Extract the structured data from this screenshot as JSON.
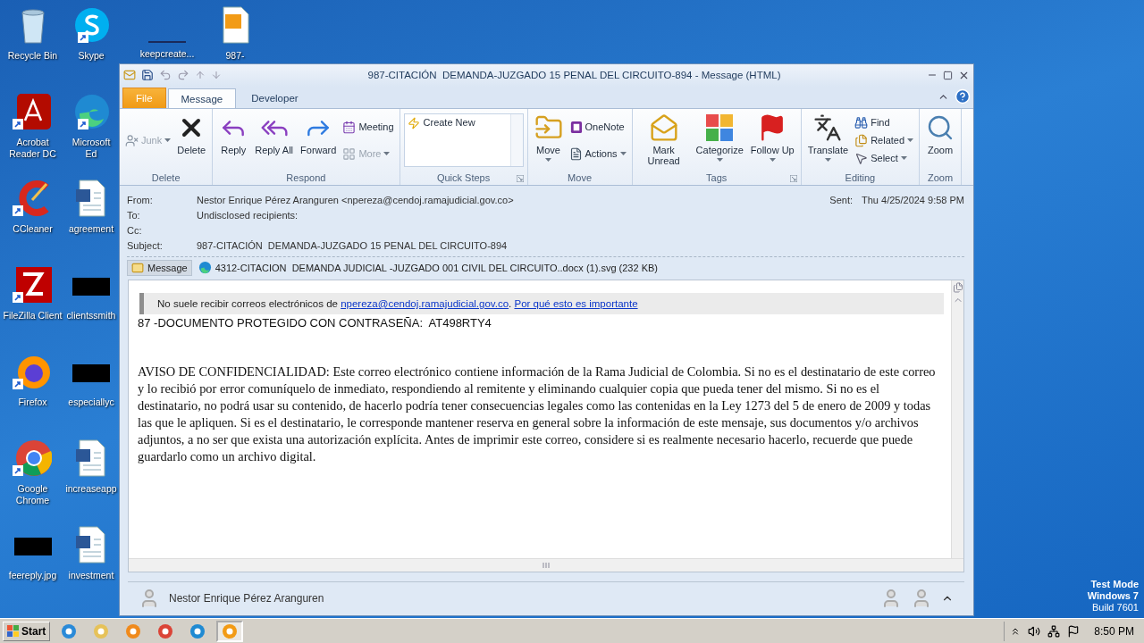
{
  "desktop": {
    "columns": [
      [
        {
          "label": "Recycle Bin",
          "kind": "recycle",
          "shortcut": false
        },
        {
          "label": "Acrobat Reader DC",
          "kind": "acrobat",
          "shortcut": true
        },
        {
          "label": "CCleaner",
          "kind": "ccleaner",
          "shortcut": true
        },
        {
          "label": "FileZilla Client",
          "kind": "filezilla",
          "shortcut": true
        },
        {
          "label": "Firefox",
          "kind": "firefox",
          "shortcut": true
        },
        {
          "label": "Google Chrome",
          "kind": "chrome",
          "shortcut": true
        },
        {
          "label": "feereply.jpg",
          "kind": "redacted",
          "shortcut": false
        }
      ],
      [
        {
          "label": "Skype",
          "kind": "skype",
          "shortcut": true
        },
        {
          "label": "Microsoft Ed",
          "kind": "edge",
          "shortcut": true
        },
        {
          "label": "agreement",
          "kind": "word",
          "shortcut": false
        },
        {
          "label": "clientssmith",
          "kind": "redacted",
          "shortcut": false
        },
        {
          "label": "especiallyc",
          "kind": "redacted",
          "shortcut": false
        },
        {
          "label": "increaseapp",
          "kind": "word",
          "shortcut": false
        },
        {
          "label": "investment",
          "kind": "word",
          "shortcut": false
        }
      ],
      [
        {
          "label": "keepcreate...",
          "kind": "blank",
          "shortcut": false
        }
      ],
      [
        {
          "label": "987-",
          "kind": "outlook-doc",
          "shortcut": false
        }
      ]
    ],
    "watermark_lines": [
      "Test Mode",
      "Windows 7",
      "Build 7601"
    ]
  },
  "window": {
    "title": "987-CITACIÓN  DEMANDA-JUZGADO 15 PENAL DEL CIRCUITO-894 - Message (HTML)",
    "tabs": [
      {
        "label": "File",
        "kind": "file",
        "selected": false
      },
      {
        "label": "Message",
        "kind": "tab",
        "selected": true
      },
      {
        "label": "Developer",
        "kind": "tab",
        "selected": false
      }
    ],
    "ribbon": [
      {
        "label": "Delete",
        "items": [
          {
            "label": "Junk",
            "kind": "junk",
            "disabled": true,
            "dropdown": true
          },
          {
            "label": "Delete",
            "kind": "delete",
            "disabled": false,
            "dropdown": false
          }
        ]
      },
      {
        "label": "Respond",
        "items": [
          {
            "label": "Reply",
            "kind": "reply",
            "disabled": false,
            "dropdown": false
          },
          {
            "label": "Reply All",
            "kind": "reply-all",
            "disabled": false,
            "dropdown": false
          },
          {
            "label": "Forward",
            "kind": "forward",
            "disabled": false,
            "dropdown": false
          },
          {
            "label": "Meeting",
            "kind": "meeting",
            "disabled": false,
            "dropdown": false
          },
          {
            "label": "More",
            "kind": "more",
            "disabled": true,
            "dropdown": true
          }
        ]
      },
      {
        "label": "Quick Steps",
        "launcher": true,
        "items": [
          {
            "label": "Create New",
            "kind": "quick-step"
          }
        ]
      },
      {
        "label": "Move",
        "items": [
          {
            "label": "Move",
            "kind": "move",
            "disabled": false,
            "dropdown": true
          },
          {
            "label": "OneNote",
            "kind": "onenote",
            "disabled": false,
            "dropdown": false
          },
          {
            "label": "Actions",
            "kind": "actions",
            "disabled": false,
            "dropdown": true
          }
        ]
      },
      {
        "label": "Tags",
        "launcher": true,
        "items": [
          {
            "label": "Mark Unread",
            "kind": "mark-unread",
            "disabled": false,
            "dropdown": false
          },
          {
            "label": "Categorize",
            "kind": "categorize",
            "disabled": false,
            "dropdown": true
          },
          {
            "label": "Follow Up",
            "kind": "follow-up",
            "disabled": false,
            "dropdown": true
          }
        ]
      },
      {
        "label": "Editing",
        "items": [
          {
            "label": "Translate",
            "kind": "translate",
            "disabled": false,
            "dropdown": true
          },
          {
            "label": "Find",
            "kind": "find",
            "disabled": false,
            "dropdown": false
          },
          {
            "label": "Related",
            "kind": "related",
            "disabled": false,
            "dropdown": true
          },
          {
            "label": "Select",
            "kind": "select",
            "disabled": false,
            "dropdown": true
          }
        ]
      },
      {
        "label": "Zoom",
        "items": [
          {
            "label": "Zoom",
            "kind": "zoom",
            "disabled": false,
            "dropdown": false
          }
        ]
      }
    ],
    "header": {
      "fields": [
        {
          "label": "From:",
          "value": "Nestor Enrique Pérez Aranguren <npereza@cendoj.ramajudicial.gov.co>"
        },
        {
          "label": "To:",
          "value": "Undisclosed recipients:"
        },
        {
          "label": "Cc:"
        },
        {
          "label": "Subject:",
          "value": "987-CITACIÓN  DEMANDA-JUZGADO 15 PENAL DEL CIRCUITO-894"
        }
      ],
      "sent": {
        "label": "Sent:",
        "value": "Thu 4/25/2024 9:58 PM"
      }
    },
    "attachments": [
      {
        "label": "Message",
        "kind": "message",
        "selected": true
      },
      {
        "label": "4312-CITACION  DEMANDA JUDICIAL -JUZGADO 001 CIVIL DEL CIRCUITO..docx (1).svg (232 KB)",
        "kind": "file",
        "selected": false
      }
    ],
    "body": {
      "notice": [
        {
          "kind": "text",
          "text": "No suele recibir correos electrónicos de "
        },
        {
          "kind": "link",
          "text": "npereza@cendoj.ramajudicial.gov.co"
        },
        {
          "kind": "text",
          "text": ". "
        },
        {
          "kind": "link",
          "text": "Por qué esto es importante"
        }
      ],
      "password_line": "87 -DOCUMENTO PROTEGIDO CON CONTRASEÑA:  AT498RTY4",
      "paragraph": "AVISO DE CONFIDENCIALIDAD: Este correo electrónico contiene información de la Rama Judicial de Colombia. Si no es el destinatario de este correo y lo recibió por error comuníquelo de inmediato, respondiendo al remitente y eliminando cualquier copia que pueda tener del mismo. Si no es el destinatario, no podrá usar su contenido, de hacerlo podría tener consecuencias legales como las contenidas en la Ley 1273 del 5 de enero de 2009 y todas las que le apliquen. Si es el destinatario, le corresponde mantener reserva en general sobre la información de este mensaje, sus documentos y/o archivos adjuntos, a no ser que exista una autorización explícita. Antes de imprimir este correo, considere si es realmente necesario hacerlo, recuerde que puede guardarlo como un archivo digital."
    },
    "people_pane": {
      "name": "Nestor Enrique Pérez Aranguren"
    }
  },
  "taskbar": {
    "start": "Start",
    "apps": [
      {
        "kind": "ie",
        "selected": false
      },
      {
        "kind": "explorer",
        "selected": false
      },
      {
        "kind": "media",
        "selected": false
      },
      {
        "kind": "chrome",
        "selected": false
      },
      {
        "kind": "edge",
        "selected": false
      },
      {
        "kind": "outlook",
        "selected": true
      }
    ],
    "time": "8:50 PM"
  }
}
